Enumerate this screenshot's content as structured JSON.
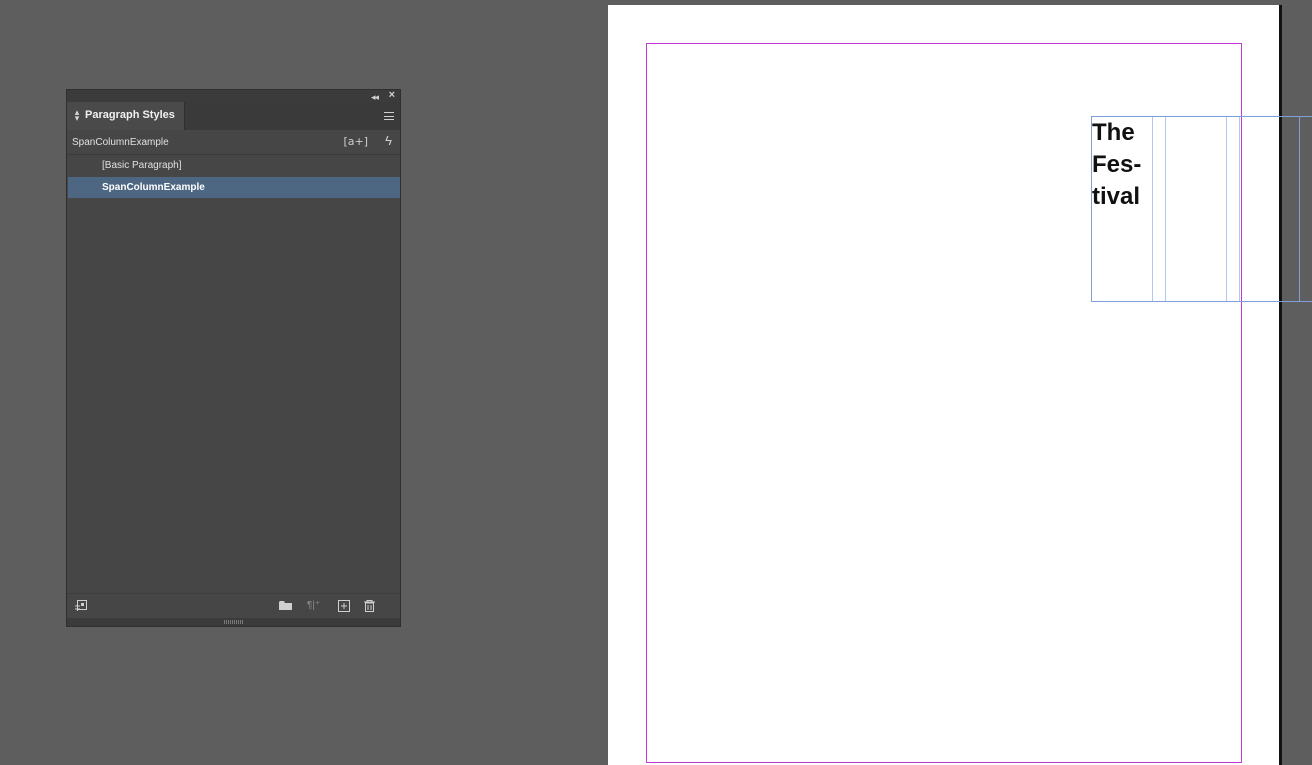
{
  "panel": {
    "tab_label": "Paragraph Styles",
    "current_style": "SpanColumnExample",
    "new_style_override_label": "[a+]",
    "styles": [
      {
        "name": "[Basic Paragraph]",
        "selected": false
      },
      {
        "name": "SpanColumnExample",
        "selected": true
      }
    ],
    "icons": {
      "collapse": "double-chevron-left-icon",
      "close": "close-icon",
      "menu": "hamburger-menu-icon",
      "quick_apply": "lightning-icon",
      "load_styles": "load-styles-icon",
      "folder": "folder-icon",
      "clear_overrides": "clear-overrides-icon",
      "new_style": "new-style-icon",
      "delete": "trash-icon"
    },
    "colors": {
      "selected_row": "#4d6682",
      "panel_bg": "#464646"
    }
  },
  "document": {
    "frame_text": "The\nFes-\ntival",
    "colors": {
      "margin_guide": "#c23ad6",
      "frame_border": "#7f9fd8"
    }
  }
}
